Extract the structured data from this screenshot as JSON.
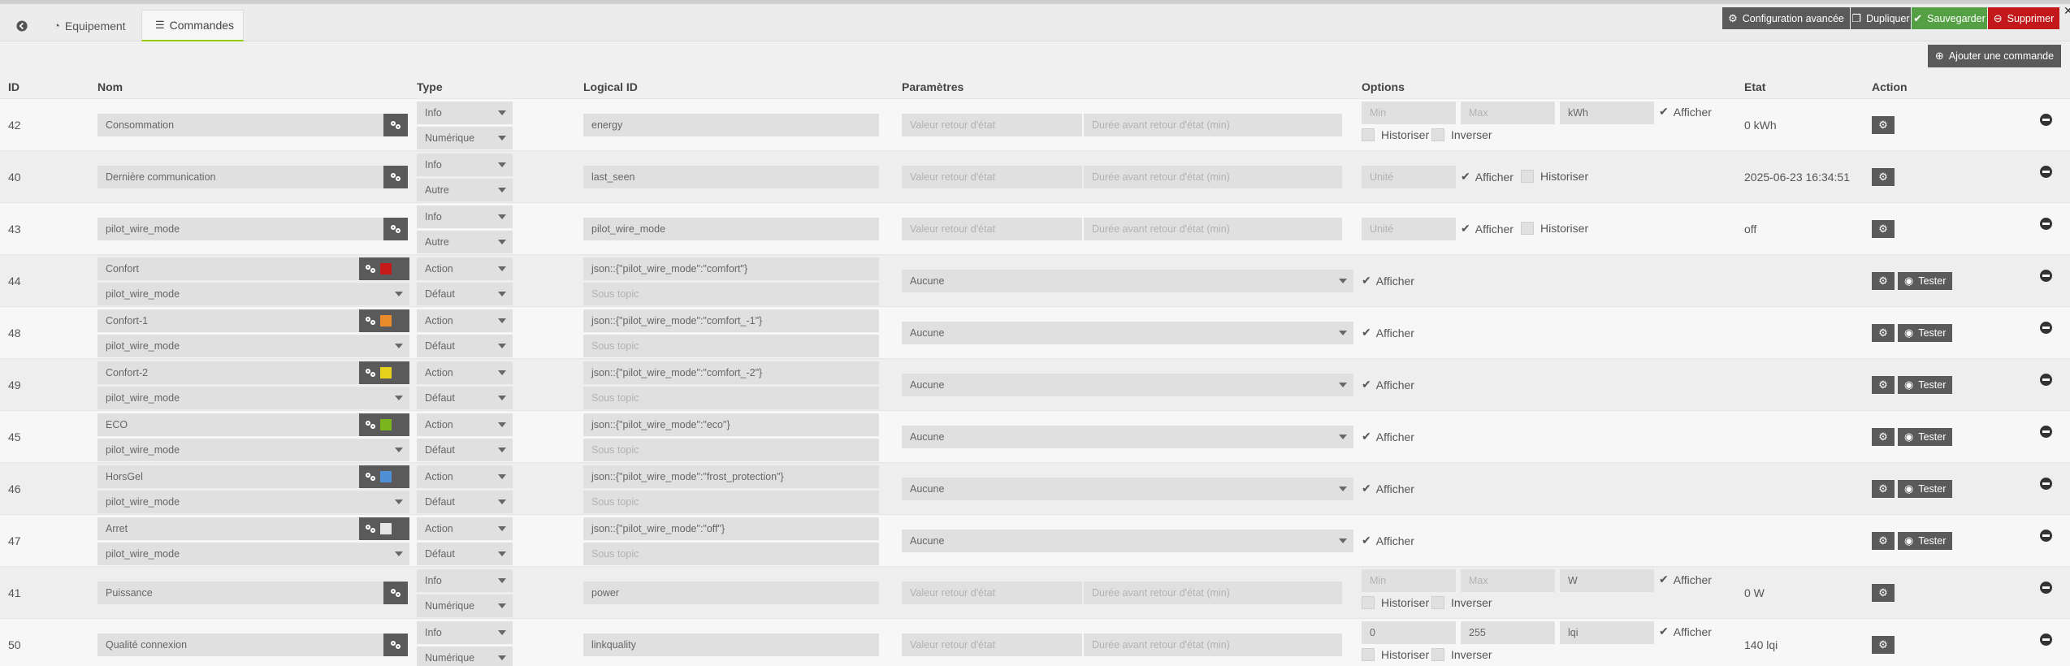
{
  "tabs": {
    "back_icon": "arrow-circle-left-icon",
    "equipement": "Equipement",
    "commandes": "Commandes"
  },
  "toolbar": {
    "config": "Configuration avancée",
    "dupliquer": "Dupliquer",
    "sauvegarder": "Sauvegarder",
    "supprimer": "Supprimer"
  },
  "add_command": "Ajouter une commande",
  "headers": {
    "id": "ID",
    "nom": "Nom",
    "type": "Type",
    "logical": "Logical ID",
    "params": "Paramètres",
    "options": "Options",
    "etat": "Etat",
    "action": "Action"
  },
  "placeholders": {
    "valeur_retour": "Valeur retour d'état",
    "duree_retour": "Durée avant retour d'état (min)",
    "unite": "Unité",
    "min": "Min",
    "max": "Max",
    "sous_topic": "Sous topic"
  },
  "labels": {
    "afficher": "Afficher",
    "historiser": "Historiser",
    "inverser": "Inverser",
    "tester": "Tester",
    "aucune": "Aucune"
  },
  "colors": {
    "confort": "#c41a1a",
    "confort1": "#e8892a",
    "confort2": "#e6d21a",
    "eco": "#7ab51d",
    "horsgel": "#4f8fd6",
    "arret": "#e6e6e6"
  },
  "rows": [
    {
      "id": "42",
      "name": "Consommation",
      "type1": "Info",
      "type2": "Numérique",
      "logical": "energy",
      "min": "Min",
      "max": "Max",
      "unit": "kWh",
      "etat": "0 kWh"
    },
    {
      "id": "40",
      "name": "Dernière communication",
      "type1": "Info",
      "type2": "Autre",
      "logical": "last_seen",
      "etat": "2025-06-23 16:34:51"
    },
    {
      "id": "43",
      "name": "pilot_wire_mode",
      "type1": "Info",
      "type2": "Autre",
      "logical": "pilot_wire_mode",
      "etat": "off"
    },
    {
      "id": "44",
      "name": "Confort",
      "sub": "pilot_wire_mode",
      "type1": "Action",
      "type2": "Défaut",
      "logical": "json::{\"pilot_wire_mode\":\"comfort\"}",
      "param": "Aucune"
    },
    {
      "id": "48",
      "name": "Confort-1",
      "sub": "pilot_wire_mode",
      "type1": "Action",
      "type2": "Défaut",
      "logical": "json::{\"pilot_wire_mode\":\"comfort_-1\"}",
      "param": "Aucune"
    },
    {
      "id": "49",
      "name": "Confort-2",
      "sub": "pilot_wire_mode",
      "type1": "Action",
      "type2": "Défaut",
      "logical": "json::{\"pilot_wire_mode\":\"comfort_-2\"}",
      "param": "Aucune"
    },
    {
      "id": "45",
      "name": "ECO",
      "sub": "pilot_wire_mode",
      "type1": "Action",
      "type2": "Défaut",
      "logical": "json::{\"pilot_wire_mode\":\"eco\"}",
      "param": "Aucune"
    },
    {
      "id": "46",
      "name": "HorsGel",
      "sub": "pilot_wire_mode",
      "type1": "Action",
      "type2": "Défaut",
      "logical": "json::{\"pilot_wire_mode\":\"frost_protection\"}",
      "param": "Aucune"
    },
    {
      "id": "47",
      "name": "Arret",
      "sub": "pilot_wire_mode",
      "type1": "Action",
      "type2": "Défaut",
      "logical": "json::{\"pilot_wire_mode\":\"off\"}",
      "param": "Aucune"
    },
    {
      "id": "41",
      "name": "Puissance",
      "type1": "Info",
      "type2": "Numérique",
      "logical": "power",
      "min": "Min",
      "max": "Max",
      "unit": "W",
      "etat": "0 W"
    },
    {
      "id": "50",
      "name": "Qualité connexion",
      "type1": "Info",
      "type2": "Numérique",
      "logical": "linkquality",
      "min": "0",
      "max": "255",
      "unit": "lqi",
      "etat": "140 lqi"
    }
  ]
}
